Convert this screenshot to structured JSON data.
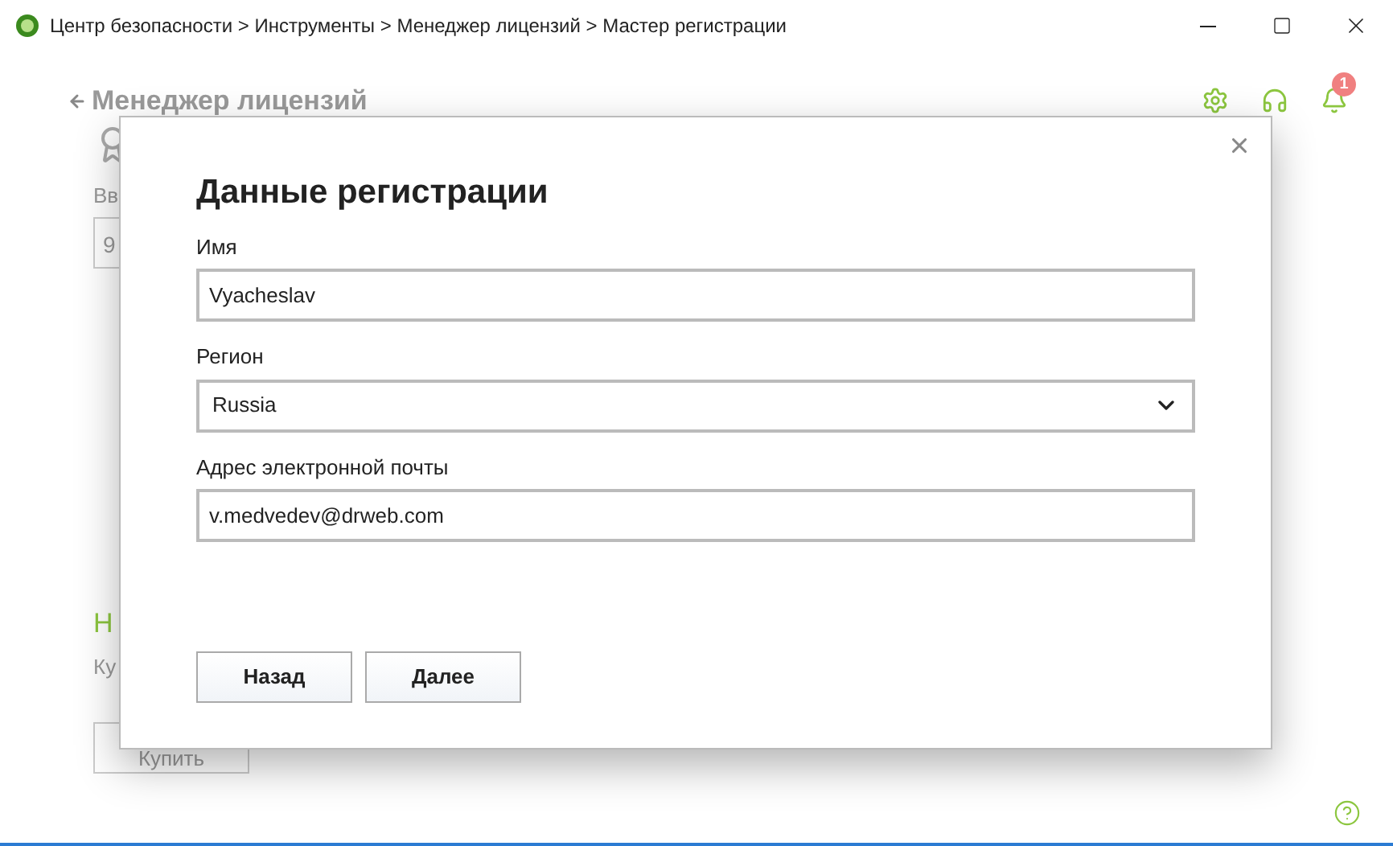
{
  "window": {
    "title": "Центр безопасности > Инструменты > Менеджер лицензий > Мастер регистрации"
  },
  "page": {
    "title": "Менеджер лицензий",
    "notifications": "1",
    "behind": {
      "label": "Вв",
      "field": "9",
      "heading": "Н",
      "text": "Ку",
      "button": "Купить"
    }
  },
  "dialog": {
    "title": "Данные регистрации",
    "fields": [
      {
        "kind": "text",
        "label": "Имя",
        "value": "Vyacheslav"
      },
      {
        "kind": "select",
        "label": "Регион",
        "value": "Russia"
      },
      {
        "kind": "text",
        "label": "Адрес электронной почты",
        "value": "v.medvedev@drweb.com"
      }
    ],
    "buttons": [
      "Назад",
      "Далее"
    ]
  }
}
